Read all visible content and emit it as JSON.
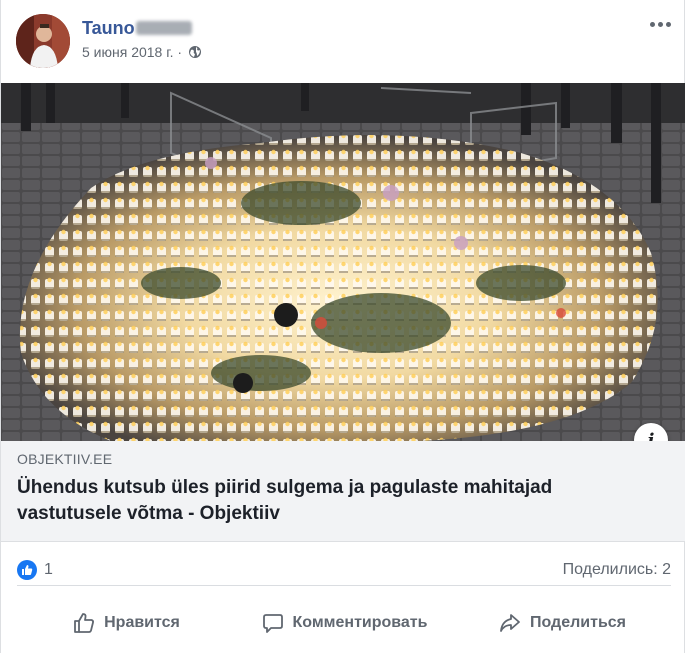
{
  "post": {
    "author": "Tauno",
    "date": "5 июня 2018 г. ·",
    "privacy_icon": "globe-icon",
    "more_icon": "more-options-icon"
  },
  "link": {
    "domain": "OBJEKTIIV.EE",
    "title": "Ühendus kutsub üles piirid sulgema ja pagulaste mahitajad vastutusele võtma - Objektiiv",
    "info_glyph": "i"
  },
  "reactions": {
    "like_count": "1",
    "shares": "Поделились: 2"
  },
  "actions": {
    "like": "Нравится",
    "comment": "Комментировать",
    "share": "Поделиться"
  },
  "colors": {
    "author_link": "#385898",
    "reaction_like": "#1877f2",
    "caption_bg": "#f2f3f5"
  }
}
